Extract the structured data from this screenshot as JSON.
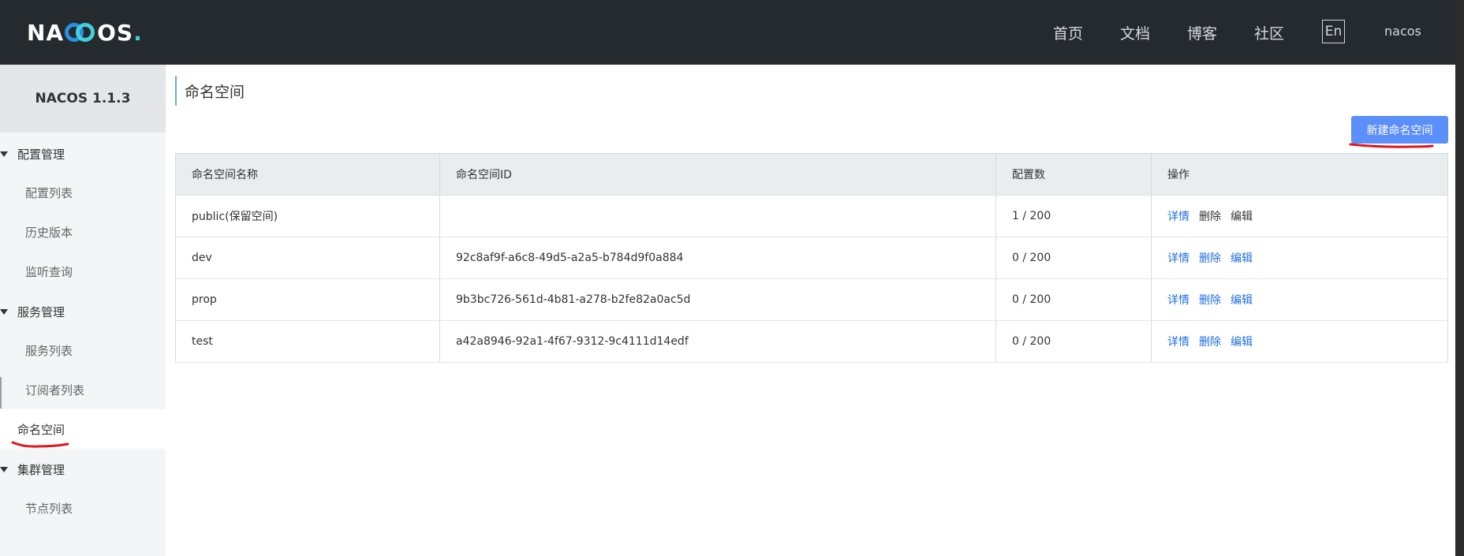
{
  "header": {
    "logo_text_left": "NA",
    "logo_text_right": "OS",
    "logo_dot": ".",
    "nav": [
      "首页",
      "文档",
      "博客",
      "社区"
    ],
    "lang": "En",
    "user": "nacos"
  },
  "sidebar": {
    "version": "NACOS 1.1.3",
    "groups": [
      {
        "label": "配置管理",
        "items": [
          "配置列表",
          "历史版本",
          "监听查询"
        ]
      },
      {
        "label": "服务管理",
        "items": [
          "服务列表",
          "订阅者列表",
          "命名空间"
        ]
      },
      {
        "label": "集群管理",
        "items": [
          "节点列表"
        ]
      }
    ]
  },
  "main": {
    "title": "命名空间",
    "create_button": "新建命名空间",
    "columns": [
      "命名空间名称",
      "命名空间ID",
      "配置数",
      "操作"
    ],
    "rows": [
      {
        "name": "public(保留空间)",
        "id": "",
        "count": "1 / 200",
        "ops": [
          "详情",
          "删除",
          "编辑"
        ]
      },
      {
        "name": "dev",
        "id": "92c8af9f-a6c8-49d5-a2a5-b784d9f0a884",
        "count": "0 / 200",
        "ops": [
          "详情",
          "删除",
          "编辑"
        ]
      },
      {
        "name": "prop",
        "id": "9b3bc726-561d-4b81-a278-b2fe82a0ac5d",
        "count": "0 / 200",
        "ops": [
          "详情",
          "删除",
          "编辑"
        ]
      },
      {
        "name": "test",
        "id": "a42a8946-92a1-4f67-9312-9c4111d14edf",
        "count": "0 / 200",
        "ops": [
          "详情",
          "删除",
          "编辑"
        ]
      }
    ]
  },
  "colors": {
    "header_bg": "#252a2f",
    "accent": "#5b8ff9",
    "link": "#1e6fe0",
    "annotation_red": "#e0161c"
  }
}
